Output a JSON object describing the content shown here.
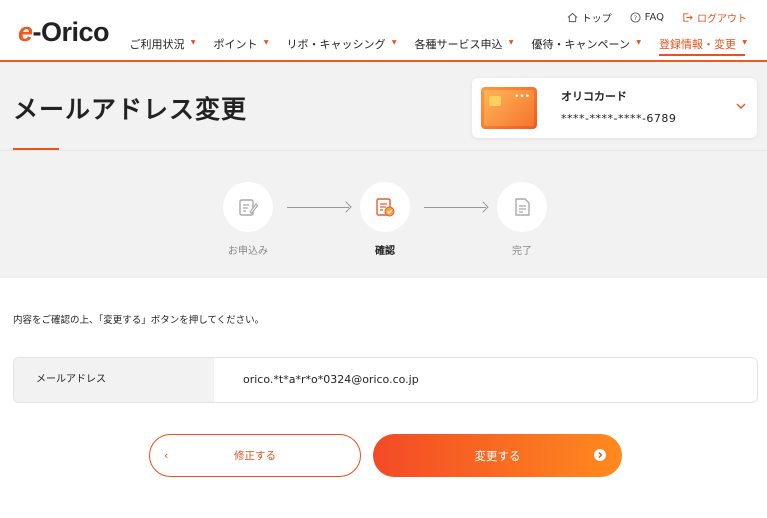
{
  "header": {
    "logo_e": "e",
    "logo_text": "-Orico",
    "util": {
      "top": "トップ",
      "faq": "FAQ",
      "logout": "ログアウト"
    },
    "nav": [
      {
        "label": "ご利用状況"
      },
      {
        "label": "ポイント"
      },
      {
        "label": "リボ・キャッシング"
      },
      {
        "label": "各種サービス申込"
      },
      {
        "label": "優待・キャンペーン"
      },
      {
        "label": "登録情報・変更"
      }
    ],
    "active_nav": "登録情報・変更"
  },
  "page": {
    "title": "メールアドレス変更"
  },
  "card": {
    "name": "オリコカード",
    "number": "****-****-****-6789",
    "dots": "•••"
  },
  "steps": [
    {
      "label": "お申込み",
      "icon": "edit-icon",
      "state": "done"
    },
    {
      "label": "確認",
      "icon": "check-document-icon",
      "state": "current"
    },
    {
      "label": "完了",
      "icon": "document-icon",
      "state": "pending"
    }
  ],
  "instruction": "内容をご確認の上、「変更する」ボタンを押してください。",
  "field": {
    "label": "メールアドレス",
    "value": "orico.*t*a*r*o*0324@orico.co.jp"
  },
  "buttons": {
    "back_label": "修正する",
    "back_chevron": "‹",
    "submit_label": "変更する"
  },
  "colors": {
    "accent": "#e8521c",
    "gradient_start": "#f34a26",
    "gradient_end": "#ff8a1e"
  }
}
